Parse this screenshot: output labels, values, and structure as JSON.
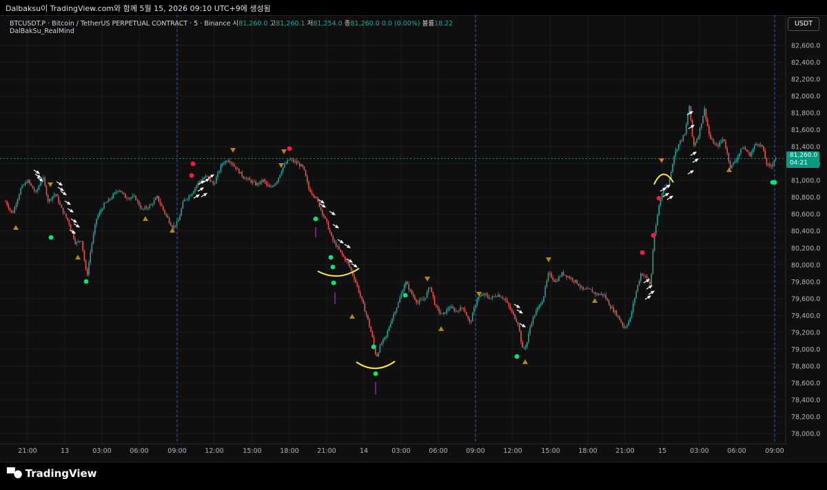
{
  "header": {
    "caption": "Dalbaksu이 TradingView.com와 함께 5월 15, 2026 09:10 UTC+9에 생성됨"
  },
  "legend": {
    "symbol": "BTCUSDT.P · Bitcoin / TetherUS PERPETUAL CONTRACT · 5 · Binance",
    "open_label": "시",
    "open": "81,260.0",
    "high_label": "고",
    "high": "81,260.1",
    "low_label": "저",
    "low": "81,254.0",
    "close_label": "종",
    "close": "81,260.0",
    "change": "0.0 (0.00%)",
    "volume_label": "볼륨",
    "volume": "18.22",
    "indicator": "DalBakSu_RealMind"
  },
  "currency_button": "USDT",
  "price_label": {
    "price": "81,260.0",
    "countdown": "04:21"
  },
  "brand": {
    "name": "TradingView"
  },
  "colors": {
    "up": "#26a69a",
    "down": "#ef5350",
    "bg": "#0f0f0f",
    "grid": "#1c1c1c",
    "separator": "#2962ff",
    "arc": "#ffeb3b",
    "signal_up": "#00e676",
    "signal_down": "#ff1744",
    "triangle": "#b8860b",
    "violet": "#9c27b0"
  },
  "chart_data": {
    "type": "candlestick",
    "y_ticks": [
      "78,000.0",
      "78,200.0",
      "78,400.0",
      "78,600.0",
      "78,800.0",
      "79,000.0",
      "79,200.0",
      "79,400.0",
      "79,600.0",
      "79,800.0",
      "80,000.0",
      "80,200.0",
      "80,400.0",
      "80,600.0",
      "80,800.0",
      "81,000.0",
      "81,200.0",
      "81,400.0",
      "81,600.0",
      "81,800.0",
      "82,000.0",
      "82,200.0",
      "82,400.0",
      "82,600.0"
    ],
    "ylim": [
      77950,
      82750
    ],
    "x_ticks": [
      "21:00",
      "13",
      "03:00",
      "06:00",
      "09:00",
      "12:00",
      "15:00",
      "18:00",
      "21:00",
      "14",
      "03:00",
      "06:00",
      "09:00",
      "12:00",
      "15:00",
      "18:00",
      "21:00",
      "15",
      "03:00",
      "06:00",
      "09:00"
    ],
    "day_separators": [
      "09:00",
      "09:00",
      "09:00"
    ],
    "last_price": 81260,
    "path": [
      [
        0,
        80850
      ],
      [
        8,
        80750
      ],
      [
        18,
        80600
      ],
      [
        30,
        80900
      ],
      [
        40,
        81000
      ],
      [
        52,
        80850
      ],
      [
        62,
        81050
      ],
      [
        70,
        80750
      ],
      [
        80,
        80850
      ],
      [
        90,
        80650
      ],
      [
        100,
        80500
      ],
      [
        110,
        80250
      ],
      [
        118,
        80300
      ],
      [
        126,
        79850
      ],
      [
        132,
        80200
      ],
      [
        140,
        80550
      ],
      [
        150,
        80700
      ],
      [
        162,
        80800
      ],
      [
        172,
        80900
      ],
      [
        182,
        80800
      ],
      [
        196,
        80800
      ],
      [
        206,
        80650
      ],
      [
        218,
        80700
      ],
      [
        228,
        80800
      ],
      [
        240,
        80600
      ],
      [
        250,
        80450
      ],
      [
        258,
        80500
      ],
      [
        266,
        80750
      ],
      [
        278,
        80850
      ],
      [
        290,
        81000
      ],
      [
        300,
        81050
      ],
      [
        310,
        80950
      ],
      [
        322,
        81200
      ],
      [
        332,
        81250
      ],
      [
        342,
        81150
      ],
      [
        352,
        81050
      ],
      [
        362,
        81000
      ],
      [
        372,
        80950
      ],
      [
        382,
        81000
      ],
      [
        392,
        80900
      ],
      [
        402,
        81000
      ],
      [
        410,
        81150
      ],
      [
        420,
        81250
      ],
      [
        432,
        81200
      ],
      [
        440,
        81150
      ],
      [
        448,
        80900
      ],
      [
        458,
        80800
      ],
      [
        466,
        80650
      ],
      [
        474,
        80500
      ],
      [
        482,
        80300
      ],
      [
        490,
        80200
      ],
      [
        498,
        80100
      ],
      [
        506,
        80000
      ],
      [
        516,
        79800
      ],
      [
        524,
        79600
      ],
      [
        532,
        79400
      ],
      [
        540,
        79150
      ],
      [
        546,
        78900
      ],
      [
        552,
        79050
      ],
      [
        560,
        79150
      ],
      [
        568,
        79350
      ],
      [
        578,
        79550
      ],
      [
        588,
        79800
      ],
      [
        598,
        79650
      ],
      [
        606,
        79550
      ],
      [
        616,
        79600
      ],
      [
        624,
        79750
      ],
      [
        632,
        79500
      ],
      [
        642,
        79400
      ],
      [
        652,
        79500
      ],
      [
        662,
        79450
      ],
      [
        672,
        79500
      ],
      [
        682,
        79300
      ],
      [
        692,
        79600
      ],
      [
        702,
        79650
      ],
      [
        712,
        79600
      ],
      [
        722,
        79650
      ],
      [
        732,
        79600
      ],
      [
        742,
        79450
      ],
      [
        752,
        79300
      ],
      [
        758,
        79000
      ],
      [
        764,
        79050
      ],
      [
        770,
        79300
      ],
      [
        778,
        79450
      ],
      [
        788,
        79600
      ],
      [
        796,
        79900
      ],
      [
        806,
        79800
      ],
      [
        816,
        79900
      ],
      [
        826,
        79850
      ],
      [
        836,
        79800
      ],
      [
        846,
        79700
      ],
      [
        856,
        79700
      ],
      [
        866,
        79650
      ],
      [
        876,
        79650
      ],
      [
        886,
        79500
      ],
      [
        896,
        79400
      ],
      [
        906,
        79250
      ],
      [
        914,
        79350
      ],
      [
        922,
        79650
      ],
      [
        930,
        79900
      ],
      [
        938,
        79850
      ],
      [
        944,
        79750
      ],
      [
        948,
        80250
      ],
      [
        956,
        80700
      ],
      [
        962,
        80900
      ],
      [
        970,
        80950
      ],
      [
        978,
        81300
      ],
      [
        986,
        81450
      ],
      [
        994,
        81550
      ],
      [
        1000,
        81900
      ],
      [
        1006,
        81400
      ],
      [
        1014,
        81550
      ],
      [
        1022,
        81850
      ],
      [
        1030,
        81500
      ],
      [
        1040,
        81400
      ],
      [
        1050,
        81500
      ],
      [
        1060,
        81150
      ],
      [
        1068,
        81250
      ],
      [
        1078,
        81400
      ],
      [
        1088,
        81300
      ],
      [
        1098,
        81450
      ],
      [
        1106,
        81400
      ],
      [
        1112,
        81200
      ],
      [
        1118,
        81150
      ],
      [
        1124,
        81260
      ]
    ]
  }
}
